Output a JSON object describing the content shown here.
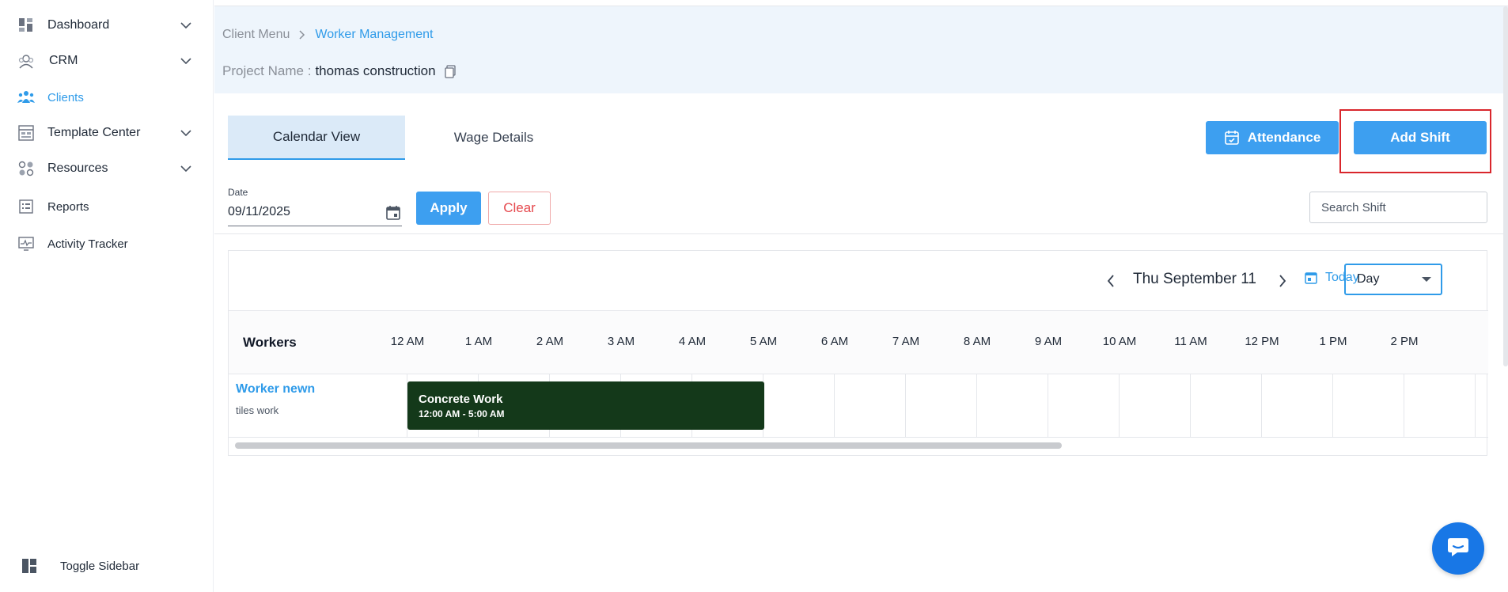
{
  "sidebar": {
    "items": [
      {
        "label": "Dashboard",
        "icon": "dashboard-icon"
      },
      {
        "label": "CRM",
        "icon": "crm-icon"
      },
      {
        "label": "Clients",
        "icon": "clients-icon",
        "active": true
      },
      {
        "label": "Template Center",
        "icon": "template-icon"
      },
      {
        "label": "Resources",
        "icon": "resources-icon"
      },
      {
        "label": "Reports",
        "icon": "reports-icon"
      },
      {
        "label": "Activity Tracker",
        "icon": "activity-icon"
      }
    ],
    "toggle_label": "Toggle Sidebar"
  },
  "breadcrumb": {
    "root": "Client Menu",
    "current": "Worker Management"
  },
  "project": {
    "label": "Project Name :",
    "value": "thomas construction"
  },
  "tabs": {
    "calendar": "Calendar View",
    "wage": "Wage Details"
  },
  "actions": {
    "attendance": "Attendance",
    "add_shift": "Add Shift"
  },
  "filter": {
    "date_label": "Date",
    "date_value": "09/11/2025",
    "apply": "Apply",
    "clear": "Clear",
    "search_placeholder": "Search Shift"
  },
  "calendar": {
    "current_date": "Thu September 11",
    "today": "Today",
    "view": "Day",
    "workers_header": "Workers",
    "hours": [
      "12 AM",
      "1 AM",
      "2 AM",
      "3 AM",
      "4 AM",
      "5 AM",
      "6 AM",
      "7 AM",
      "8 AM",
      "9 AM",
      "10 AM",
      "11 AM",
      "12 PM",
      "1 PM",
      "2 PM"
    ],
    "workers": [
      {
        "name": "Worker newn",
        "role": "tiles work",
        "shift": {
          "title": "Concrete Work",
          "time": "12:00 AM - 5:00 AM",
          "color": "#14391a"
        }
      }
    ]
  },
  "colors": {
    "accent": "#2f9be9",
    "primary_button": "#3d9ff0",
    "highlight": "#d9262c",
    "shift": "#14391a"
  }
}
